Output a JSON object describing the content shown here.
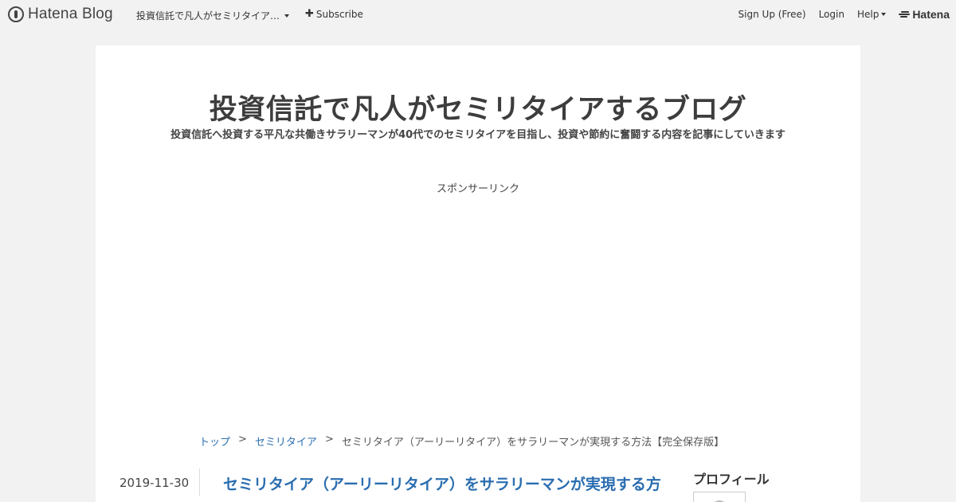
{
  "globalbar": {
    "logo_text": "Hatena Blog",
    "blog_select_label": "投資信託で凡人がセミリタイア…",
    "subscribe_label": "Subscribe",
    "signup_label": "Sign Up (Free)",
    "login_label": "Login",
    "help_label": "Help",
    "hatena_label": "Hatena"
  },
  "blog": {
    "title": "投資信託で凡人がセミリタイアするブログ",
    "description": "投資信託へ投資する平凡な共働きサラリーマンが40代でのセミリタイアを目指し、投資や節約に奮闘する内容を記事にしていきます",
    "sponsor_label": "スポンサーリンク"
  },
  "breadcrumb": {
    "items": [
      "トップ",
      "セミリタイア",
      "セミリタイア（アーリーリタイア）をサラリーマンが実現する方法【完全保存版】"
    ],
    "separator": ">"
  },
  "entry": {
    "date": "2019-11-30",
    "title": "セミリタイア（アーリーリタイア）をサラリーマンが実現する方"
  },
  "sidebar": {
    "profile_title": "プロフィール"
  },
  "colors": {
    "background": "#f2f2f2",
    "link": "#2a6db0",
    "text": "#333333"
  }
}
